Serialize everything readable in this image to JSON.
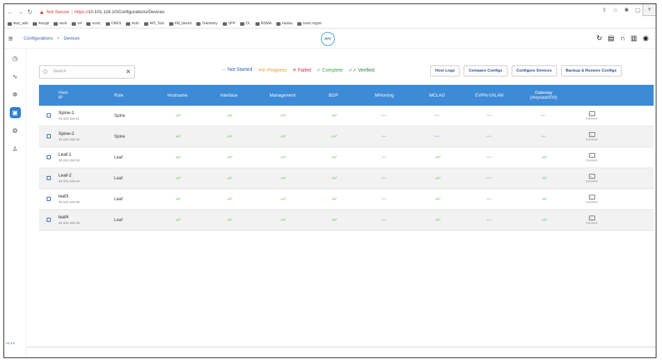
{
  "browser": {
    "not_secure": "Not Secure",
    "scheme": "https://",
    "host_path": "10.101.118.10/Configurations/Devices"
  },
  "bookmarks": [
    "Aviz_wiki",
    "Avizgit",
    "work",
    "ref",
    "sonic",
    "ONES",
    "Auto",
    "API_Test",
    "FM_bkend",
    "Telemetry",
    "VPP",
    "DL",
    "RDMA",
    "Harika",
    "sonic-mgmt"
  ],
  "header": {
    "breadcrumb_root": "Configurations",
    "breadcrumb_sep": ">",
    "breadcrumb_page": "Devices",
    "logo_text": "aviz"
  },
  "sidebar": {
    "version": "v1.3.0"
  },
  "toolbar": {
    "search_placeholder": "Search",
    "legend": {
      "not_started": "··· Not Started",
      "in_progress": "In Progress",
      "failed": "✕ Failed",
      "complete": "✓ Complete",
      "verified": "✓✓ Verified"
    },
    "buttons": {
      "host_logs": "Host Logs",
      "compare_configs": "Compare Configs",
      "configure_devices": "Configure Devices",
      "backup_restore": "Backup & Restore Configs"
    }
  },
  "table": {
    "headers": {
      "host": "Host",
      "ip": "IP",
      "role": "Role",
      "hostname": "Hostname",
      "interface": "Interface",
      "management": "Management",
      "bgp": "BGP",
      "mhoming": "MHoming",
      "mclag": "MCLAG",
      "evpn": "EVPN-VXLAN",
      "gateway": "Gateway",
      "gateway_sub": "(Anycast/SVI)"
    },
    "connect_label": "Connect",
    "rows": [
      {
        "host": "Spine-1",
        "ip": "10.101.118.11",
        "role": "Spine",
        "hostname": "verified",
        "interface": "verified",
        "management": "verified",
        "bgp": "verified",
        "mhoming": "not_started",
        "mclag": "not_started",
        "evpn": "not_started",
        "gateway": "not_started"
      },
      {
        "host": "Spine-2",
        "ip": "10.101.118.12",
        "role": "Spine",
        "hostname": "verified",
        "interface": "verified",
        "management": "verified",
        "bgp": "verified",
        "mhoming": "not_started",
        "mclag": "not_started",
        "evpn": "not_started",
        "gateway": "not_started"
      },
      {
        "host": "Leaf-1",
        "ip": "10.101.118.13",
        "role": "Leaf",
        "hostname": "verified",
        "interface": "verified",
        "management": "verified",
        "bgp": "verified",
        "mhoming": "not_started",
        "mclag": "verified",
        "evpn": "not_started",
        "gateway": "verified"
      },
      {
        "host": "Leaf-2",
        "ip": "10.101.118.14",
        "role": "Leaf",
        "hostname": "verified",
        "interface": "verified",
        "management": "verified",
        "bgp": "verified",
        "mhoming": "not_started",
        "mclag": "verified",
        "evpn": "not_started",
        "gateway": "verified"
      },
      {
        "host": "leaf3",
        "ip": "10.101.118.15",
        "role": "Leaf",
        "hostname": "verified",
        "interface": "verified",
        "management": "verified",
        "bgp": "verified",
        "mhoming": "not_started",
        "mclag": "verified",
        "evpn": "not_started",
        "gateway": "verified"
      },
      {
        "host": "leaf4",
        "ip": "10.101.118.16",
        "role": "Leaf",
        "hostname": "verified",
        "interface": "verified",
        "management": "verified",
        "bgp": "verified",
        "mhoming": "not_started",
        "mclag": "verified",
        "evpn": "not_started",
        "gateway": "verified"
      }
    ]
  }
}
